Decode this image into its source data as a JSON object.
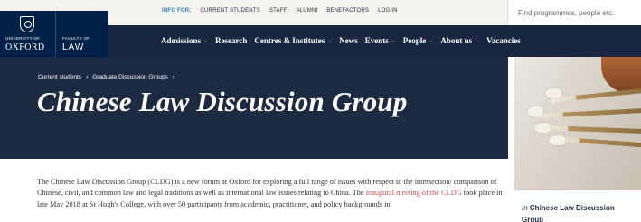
{
  "utility": {
    "info_for_label": "INFO FOR:",
    "links": [
      "CURRENT STUDENTS",
      "STAFF",
      "ALUMNI",
      "BENEFACTORS",
      "LOG IN"
    ]
  },
  "search": {
    "placeholder": "Find programmes, people etc."
  },
  "logo": {
    "university_small": "UNIVERSITY OF",
    "university_big": "OXFORD",
    "faculty_small": "FACULTY OF",
    "faculty_big": "LAW"
  },
  "nav": {
    "items": [
      {
        "label": "Admissions",
        "has_menu": true
      },
      {
        "label": "Research",
        "has_menu": false
      },
      {
        "label": "Centres & Institutes",
        "has_menu": true
      },
      {
        "label": "News",
        "has_menu": false
      },
      {
        "label": "Events",
        "has_menu": true
      },
      {
        "label": "People",
        "has_menu": true
      },
      {
        "label": "About us",
        "has_menu": true
      },
      {
        "label": "Vacancies",
        "has_menu": false
      }
    ]
  },
  "breadcrumb": [
    "Current students",
    "Graduate Discussion Groups"
  ],
  "page": {
    "title": "Chinese Law Discussion Group"
  },
  "intro": {
    "text_before_link": "The Chinese Law Discussion Group (CLDG) is a new forum at Oxford for exploring a full range of issues with respect to the intersection/ comparison of Chinese, civil, and common law and legal traditions as well as international law issues relating to China. The ",
    "link_text": "inaugural meeting of the CLDG",
    "text_after_link": " took place in late May 2018 at St Hugh's College, with over 50 participants from academic, practitioner, and policy backgrounds in"
  },
  "sidebar": {
    "caption_prefix": "In",
    "caption_title": "Chinese Law Discussion Group"
  },
  "colors": {
    "nav_bg": "#18273f",
    "hero_bg": "#1c2b42",
    "logo_bg": "#002147",
    "link": "#c94f4f",
    "info_for": "#2f7db1"
  }
}
